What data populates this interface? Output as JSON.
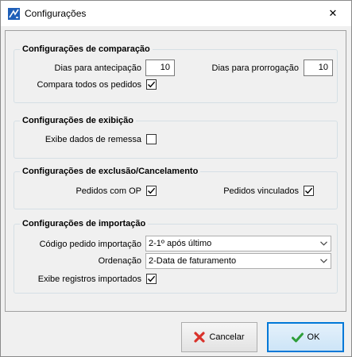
{
  "window": {
    "title": "Configurações",
    "close_glyph": "✕",
    "icon": "app-icon"
  },
  "comparacao": {
    "title": "Configurações de comparação",
    "dias_antecipacao_label": "Dias para antecipação",
    "dias_antecipacao_value": "10",
    "dias_prorrogacao_label": "Dias para prorrogação",
    "dias_prorrogacao_value": "10",
    "compara_todos_label": "Compara todos os pedidos",
    "compara_todos_checked": true
  },
  "exibicao": {
    "title": "Configurações de exibição",
    "exibe_remessa_label": "Exibe dados de remessa",
    "exibe_remessa_checked": false
  },
  "exclusao": {
    "title": "Configurações de exclusão/Cancelamento",
    "pedidos_op_label": "Pedidos com OP",
    "pedidos_op_checked": true,
    "pedidos_vinculados_label": "Pedidos vinculados",
    "pedidos_vinculados_checked": true
  },
  "importacao": {
    "title": "Configurações de importação",
    "codigo_label": "Código pedido importação",
    "codigo_value": "2-1º após último",
    "ordenacao_label": "Ordenação",
    "ordenacao_value": "2-Data de faturamento",
    "exibe_registros_label": "Exibe registros importados",
    "exibe_registros_checked": true
  },
  "footer": {
    "cancel_label": "Cancelar",
    "ok_label": "OK"
  },
  "colors": {
    "ok_border": "#0078d7",
    "cancel_icon": "#d9322b",
    "ok_icon": "#2e9e3a"
  }
}
